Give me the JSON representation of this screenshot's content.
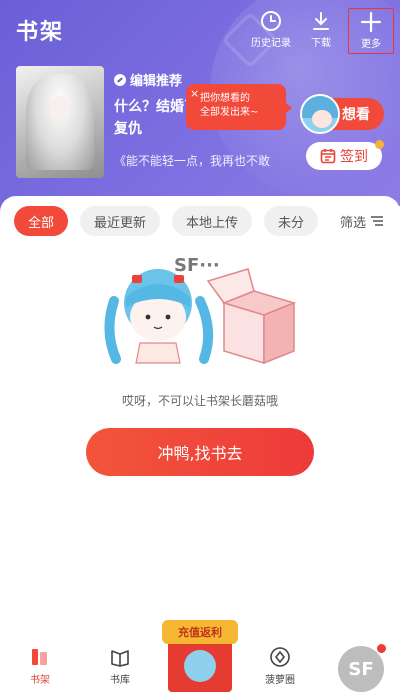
{
  "header": {
    "title": "书架",
    "actions": [
      {
        "label": "历史记录",
        "icon": "clock-icon"
      },
      {
        "label": "下载",
        "icon": "download-icon"
      },
      {
        "label": "更多",
        "icon": "plus-icon"
      }
    ]
  },
  "recommend": {
    "tag": "编辑推荐",
    "title": "什么？结婚了？重生，重生复仇",
    "description": "《能不能轻一点，我再也不敢",
    "tooltip": {
      "line1": "把你想看的",
      "line2": "全部发出来~",
      "close": "×"
    },
    "want_button": "想看",
    "checkin_button": "签到"
  },
  "filters": {
    "chips": [
      "全部",
      "最近更新",
      "本地上传",
      "未分"
    ],
    "active_index": 0,
    "filter_label": "筛选"
  },
  "empty": {
    "logo_text": "SF···",
    "message": "哎呀，不可以让书架长蘑菇哦",
    "cta": "冲鸭,找书去"
  },
  "promo": {
    "label": "充值返利"
  },
  "bottom_nav": [
    {
      "label": "书架",
      "icon": "bookshelf-icon",
      "active": true
    },
    {
      "label": "书库",
      "icon": "book-library-icon",
      "active": false
    },
    {
      "label": "菠萝圈",
      "icon": "pineapple-circle-icon",
      "active": false
    }
  ],
  "profile": {
    "avatar_text": "SF"
  },
  "colors": {
    "accent": "#f24a3a",
    "header": "#6a5fd6"
  }
}
